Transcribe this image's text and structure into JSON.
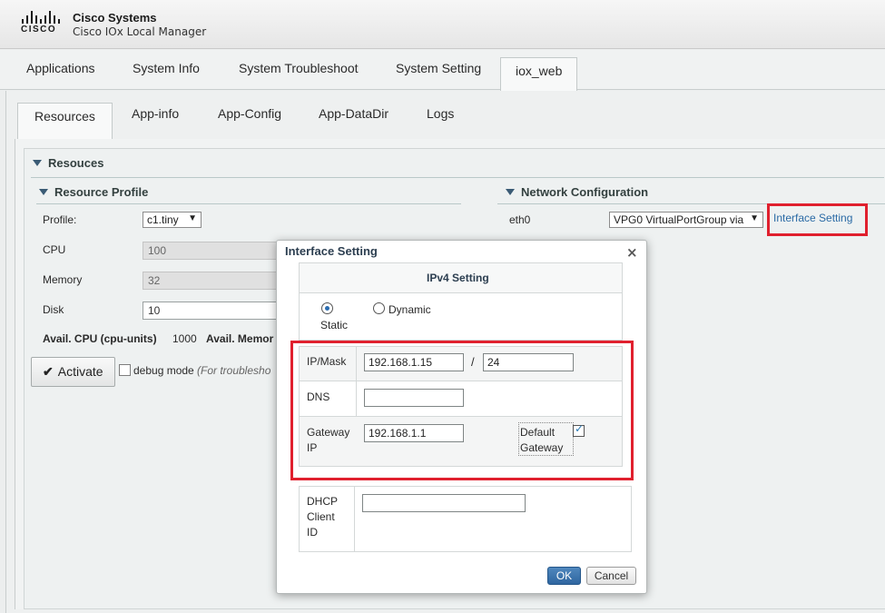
{
  "header": {
    "logo_text": "CISCO",
    "brand": "Cisco Systems",
    "product": "Cisco IOx Local Manager"
  },
  "topnav": {
    "tabs": [
      "Applications",
      "System Info",
      "System Troubleshoot",
      "System Setting",
      "iox_web"
    ]
  },
  "subnav": {
    "tabs": [
      "Resources",
      "App-info",
      "App-Config",
      "App-DataDir",
      "Logs"
    ]
  },
  "resources": {
    "section_title": "Resouces",
    "profile_section": {
      "title": "Resource Profile",
      "profile_label": "Profile:",
      "profile_value": "c1.tiny",
      "cpu_label": "CPU",
      "cpu_value": "100",
      "memory_label": "Memory",
      "memory_value": "32",
      "disk_label": "Disk",
      "disk_value": "10",
      "avail_cpu_label": "Avail. CPU (cpu-units)",
      "avail_cpu_value": "1000",
      "avail_memory_label": "Avail. Memor"
    },
    "activate_label": "Activate",
    "debug_label": "debug mode",
    "debug_hint": "(For troublesho"
  },
  "network": {
    "title": "Network Configuration",
    "iface_label": "eth0",
    "iface_select": "VPG0    VirtualPortGroup via",
    "iface_link": "Interface Setting"
  },
  "modal": {
    "title": "Interface Setting",
    "close": "×",
    "section_header": "IPv4 Setting",
    "static_label": "Static",
    "dynamic_label": "Dynamic",
    "ip_mask_label": "IP/Mask",
    "ip_value": "192.168.1.15",
    "slash": "/",
    "mask_value": "24",
    "dns_label": "DNS",
    "dns_value": "",
    "gateway_label_1": "Gateway",
    "gateway_label_2": "IP",
    "gateway_value": "192.168.1.1",
    "default_gateway_1": "Default",
    "default_gateway_2": "Gateway",
    "dhcp_label_1": "DHCP",
    "dhcp_label_2": "Client",
    "dhcp_label_3": "ID",
    "dhcp_value": "",
    "ok_label": "OK",
    "cancel_label": "Cancel"
  },
  "colors": {
    "highlight_red": "#e0202e",
    "link_blue": "#2a6aa5",
    "ok_blue": "#2f66a0"
  }
}
